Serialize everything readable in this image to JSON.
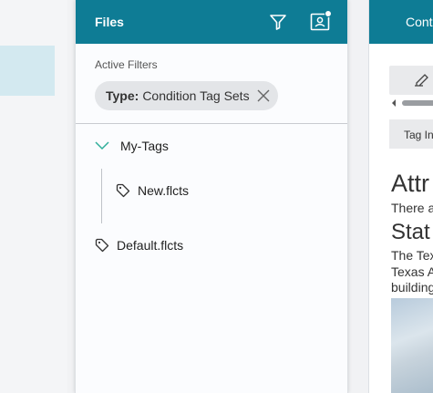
{
  "files_panel": {
    "title": "Files",
    "filter_icon": "filter-icon",
    "contact_icon": "contact-card-icon",
    "active_filters_label": "Active Filters",
    "filter_chip": {
      "key": "Type:",
      "value": "Condition Tag Sets"
    },
    "tree": {
      "folder": {
        "label": "My-Tags",
        "expanded": true,
        "children": [
          {
            "label": "New.flcts"
          }
        ]
      },
      "root_files": [
        {
          "label": "Default.flcts"
        }
      ]
    }
  },
  "content_panel": {
    "tab_label": "Conte",
    "tag_tab_label": "Tag In",
    "heading_1": "Attr",
    "para_1": "There a",
    "heading_2": "Stat",
    "para_2_lines": [
      "The Tex",
      "Texas A",
      "building"
    ]
  },
  "colors": {
    "header": "#0e7c95",
    "chevron": "#2fae9a",
    "selected_bg": "#d3e9f0"
  }
}
